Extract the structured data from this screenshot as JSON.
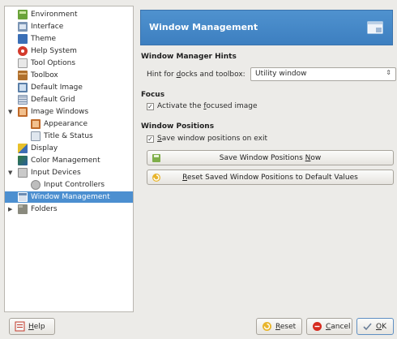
{
  "sidebar": {
    "items": [
      {
        "label": "Environment",
        "icon": "environment-icon"
      },
      {
        "label": "Interface",
        "icon": "interface-icon"
      },
      {
        "label": "Theme",
        "icon": "theme-icon"
      },
      {
        "label": "Help System",
        "icon": "help-system-icon"
      },
      {
        "label": "Tool Options",
        "icon": "tool-options-icon"
      },
      {
        "label": "Toolbox",
        "icon": "toolbox-icon"
      },
      {
        "label": "Default Image",
        "icon": "default-image-icon"
      },
      {
        "label": "Default Grid",
        "icon": "default-grid-icon"
      },
      {
        "label": "Image Windows",
        "icon": "image-windows-icon"
      },
      {
        "label": "Appearance",
        "icon": "appearance-icon"
      },
      {
        "label": "Title & Status",
        "icon": "title-status-icon"
      },
      {
        "label": "Display",
        "icon": "display-icon"
      },
      {
        "label": "Color Management",
        "icon": "color-management-icon"
      },
      {
        "label": "Input Devices",
        "icon": "input-devices-icon"
      },
      {
        "label": "Input Controllers",
        "icon": "input-controllers-icon"
      },
      {
        "label": "Window Management",
        "icon": "window-management-icon"
      },
      {
        "label": "Folders",
        "icon": "folders-icon"
      }
    ]
  },
  "header": {
    "title": "Window Management"
  },
  "hints": {
    "section_title": "Window Manager Hints",
    "docks_label_pre": "Hint for ",
    "docks_label_mnemonic": "d",
    "docks_label_post": "ocks and toolbox:",
    "docks_value": "Utility window"
  },
  "focus": {
    "section_title": "Focus",
    "activate_pre": "Activate the ",
    "activate_mnemonic": "f",
    "activate_post": "ocused image",
    "activate_checked": "✓"
  },
  "positions": {
    "section_title": "Window Positions",
    "save_on_exit_mnemonic": "S",
    "save_on_exit_post": "ave window positions on exit",
    "save_on_exit_checked": "✓",
    "save_now_pre": "Save Window Positions ",
    "save_now_mnemonic": "N",
    "save_now_post": "ow",
    "reset_mnemonic": "R",
    "reset_post": "eset Saved Window Positions to Default Values"
  },
  "footer": {
    "help_mnemonic": "H",
    "help_post": "elp",
    "reset_mnemonic": "R",
    "reset_post": "eset",
    "cancel_mnemonic": "C",
    "cancel_post": "ancel",
    "ok_mnemonic": "O",
    "ok_post": "K"
  },
  "colors": {
    "accent": "#4c8fd0",
    "header_bg": "#4587c7",
    "window_bg": "#ecebe8"
  }
}
